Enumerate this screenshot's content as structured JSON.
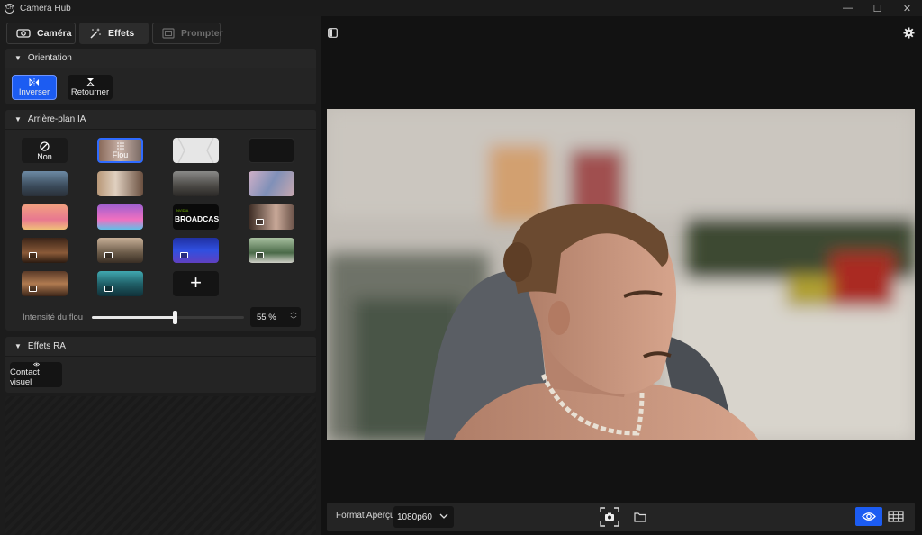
{
  "app": {
    "title": "Camera Hub",
    "logo_text": "CH"
  },
  "window_controls": {
    "minimize": "—",
    "maximize": "☐",
    "close": "✕"
  },
  "tabs": [
    {
      "label": "Caméra",
      "icon": "camera-icon",
      "active": false
    },
    {
      "label": "Effets",
      "icon": "magic-wand-icon",
      "active": true
    },
    {
      "label": "Prompter",
      "icon": "prompter-icon",
      "active": false,
      "disabled": true
    }
  ],
  "orientation": {
    "title": "Orientation",
    "buttons": [
      {
        "label": "Inverser",
        "icon": "flip-horizontal-icon",
        "active": true
      },
      {
        "label": "Retourner",
        "icon": "flip-vertical-icon",
        "active": false
      }
    ]
  },
  "background": {
    "title": "Arrière-plan IA",
    "none_label": "Non",
    "blur_label": "Flou",
    "broadcast_label": "BROADCAST",
    "broadcast_sub": "NVIDIA",
    "add_label": "+",
    "slider_label": "Intensité du flou",
    "slider_value": "55 %",
    "slider_fraction": 0.55
  },
  "ra": {
    "title": "Effets RA",
    "buttons": [
      {
        "label": "Contact visuel",
        "icon": "eye-contact-icon"
      }
    ]
  },
  "preview_bar": {
    "format_label": "Format Aperçu",
    "format_value": "1080p60"
  },
  "colors": {
    "accent": "#1c5cf2",
    "panel": "#242424",
    "background": "#171717"
  }
}
